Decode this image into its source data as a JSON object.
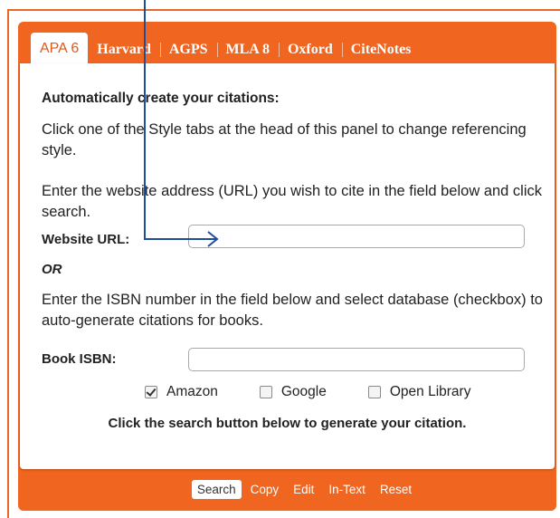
{
  "tabs": [
    {
      "label": "APA 6",
      "active": true
    },
    {
      "label": "Harvard",
      "active": false
    },
    {
      "label": "AGPS",
      "active": false
    },
    {
      "label": "MLA 8",
      "active": false
    },
    {
      "label": "Oxford",
      "active": false
    },
    {
      "label": "CiteNotes",
      "active": false
    }
  ],
  "content": {
    "heading": "Automatically create your citations:",
    "style_hint": "Click one of the Style tabs at the head of this panel to change referencing style.",
    "url_hint": "Enter the website address (URL) you wish to cite in the field below and click search.",
    "url_label": "Website URL:",
    "url_value": "",
    "or_label": "OR",
    "isbn_hint": "Enter the ISBN number in the field below and select database (checkbox) to auto-generate citations for books.",
    "isbn_label": "Book ISBN:",
    "isbn_value": "",
    "databases": [
      {
        "label": "Amazon",
        "checked": true
      },
      {
        "label": "Google",
        "checked": false
      },
      {
        "label": "Open Library",
        "checked": false
      }
    ],
    "search_instruction": "Click the search button below to generate your citation."
  },
  "actions": {
    "search": "Search",
    "copy": "Copy",
    "edit": "Edit",
    "in_text": "In-Text",
    "reset": "Reset"
  },
  "colors": {
    "brand_orange": "#f0651f",
    "active_tab_text": "#e2571a",
    "annotation_arrow": "#1f4e9a"
  }
}
